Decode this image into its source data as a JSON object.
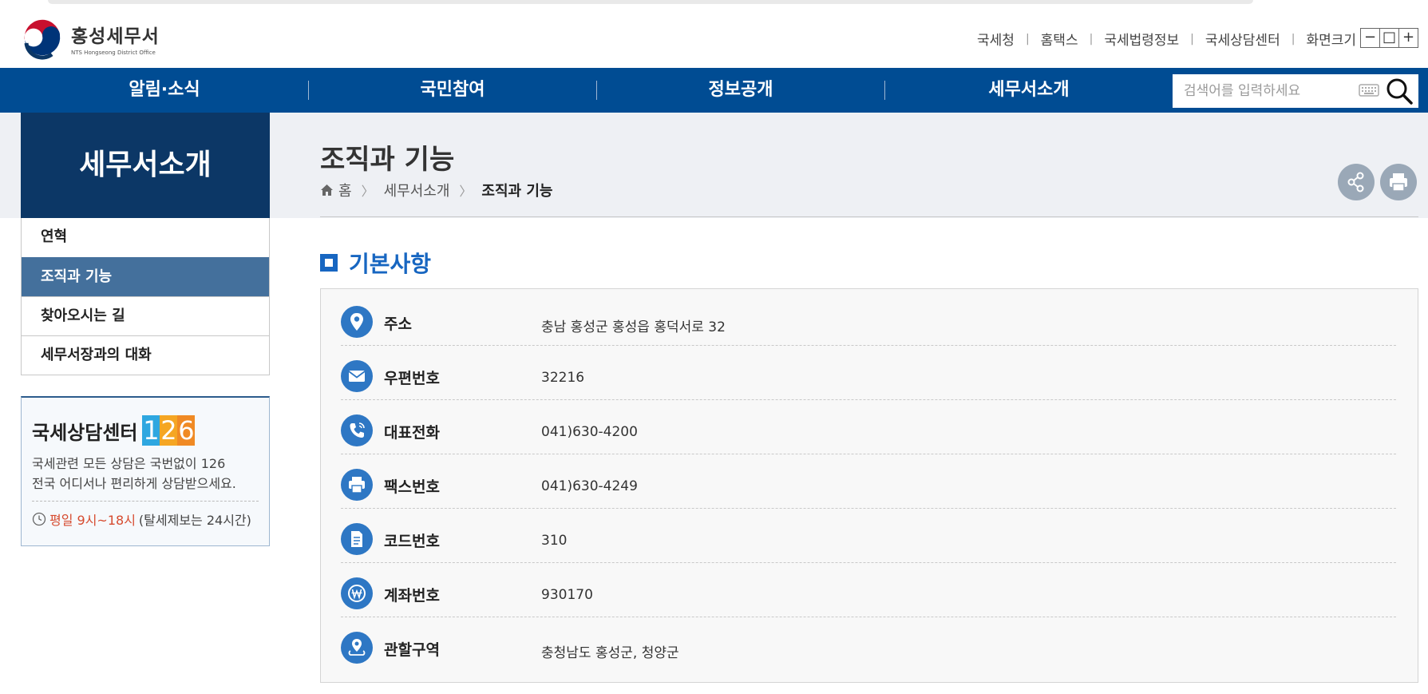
{
  "site": {
    "logo_title": "홍성세무서",
    "logo_sub": "NTS Hongseong District Office"
  },
  "util_nav": [
    "국세청",
    "홈택스",
    "국세법령정보",
    "국세상담센터",
    "화면크기"
  ],
  "zoom_buttons": [
    "−",
    "□",
    "+"
  ],
  "gnb": [
    "알림·소식",
    "국민참여",
    "정보공개",
    "세무서소개"
  ],
  "search": {
    "placeholder": "검색어를 입력하세요"
  },
  "sidebar": {
    "title": "세무서소개",
    "items": [
      {
        "label": "연혁",
        "active": false
      },
      {
        "label": "조직과 기능",
        "active": true
      },
      {
        "label": "찾아오시는 길",
        "active": false
      },
      {
        "label": "세무서장과의 대화",
        "active": false
      }
    ]
  },
  "consult": {
    "title": "국세상담센터",
    "number_digits": [
      "1",
      "2",
      "6"
    ],
    "desc_line1": "국세관련 모든 상담은 국번없이 126",
    "desc_line2": "전국 어디서나 편리하게 상담받으세요.",
    "hours": "평일 9시~18시",
    "hours_note": "(탈세제보는 24시간)"
  },
  "page": {
    "title": "조직과 기능",
    "breadcrumb": [
      "홈",
      "세무서소개",
      "조직과 기능"
    ]
  },
  "section": {
    "title": "기본사항",
    "rows": [
      {
        "icon": "location-pin-icon",
        "label": "주소",
        "value": "충남 홍성군 홍성읍 홍덕서로 32"
      },
      {
        "icon": "envelope-icon",
        "label": "우편번호",
        "value": "32216"
      },
      {
        "icon": "phone-icon",
        "label": "대표전화",
        "value": "041)630-4200"
      },
      {
        "icon": "fax-printer-icon",
        "label": "팩스번호",
        "value": "041)630-4249"
      },
      {
        "icon": "document-icon",
        "label": "코드번호",
        "value": "310"
      },
      {
        "icon": "won-coin-icon",
        "label": "계좌번호",
        "value": "930170"
      },
      {
        "icon": "area-pin-icon",
        "label": "관할구역",
        "value": "충청남도 홍성군, 청양군"
      }
    ]
  },
  "colors": {
    "gnb_bg": "#004c93",
    "side_title_bg": "#0c3766",
    "side_active_bg": "#44709c",
    "accent_blue": "#1766c1",
    "icon_blue": "#2e77c4",
    "hours_red": "#d64b2f"
  }
}
